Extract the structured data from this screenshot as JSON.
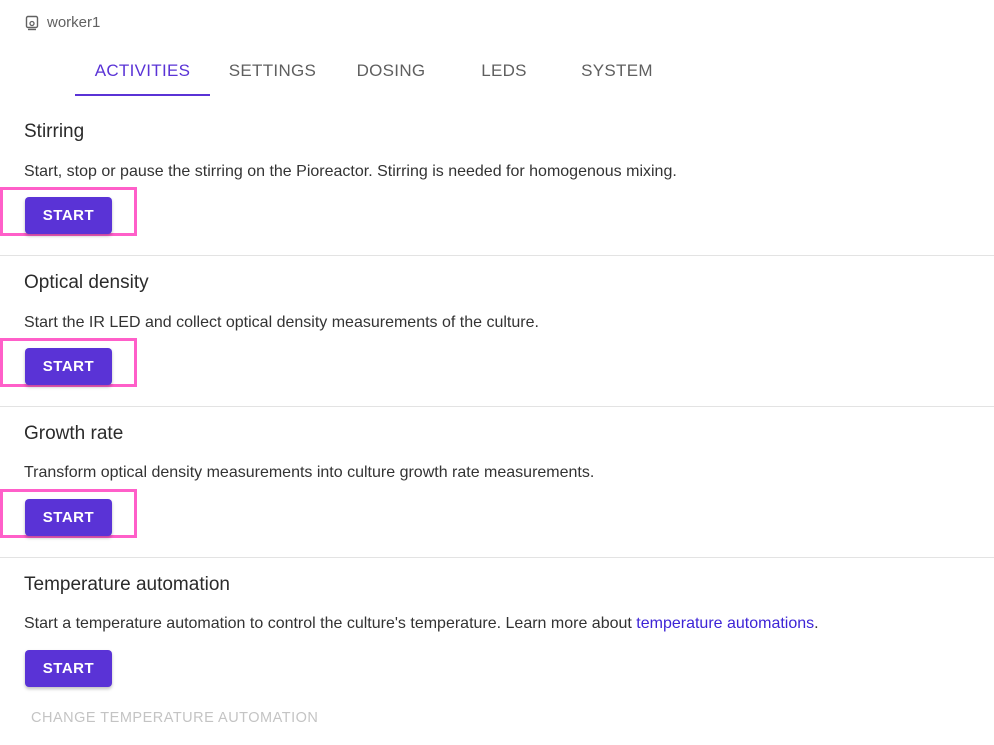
{
  "device": {
    "name": "worker1",
    "icon": "pioreactor-device-icon"
  },
  "tabs": [
    {
      "label": "ACTIVITIES",
      "active": true
    },
    {
      "label": "SETTINGS",
      "active": false
    },
    {
      "label": "DOSING",
      "active": false
    },
    {
      "label": "LEDS",
      "active": false
    },
    {
      "label": "SYSTEM",
      "active": false
    }
  ],
  "sections": [
    {
      "title": "Stirring",
      "description": "Start, stop or pause the stirring on the Pioreactor. Stirring is needed for homogenous mixing.",
      "button": "START",
      "highlighted": true
    },
    {
      "title": "Optical density",
      "description": "Start the IR LED and collect optical density measurements of the culture.",
      "button": "START",
      "highlighted": true
    },
    {
      "title": "Growth rate",
      "description": "Transform optical density measurements into culture growth rate measurements.",
      "button": "START",
      "highlighted": true
    },
    {
      "title": "Temperature automation",
      "description": "Start a temperature automation to control the culture's temperature. Learn more about ",
      "link_text": "temperature automations",
      "description_end": ".",
      "button": "START",
      "highlighted": false
    }
  ],
  "change_automation_label": "CHANGE TEMPERATURE AUTOMATION",
  "colors": {
    "accent": "#5a33d6",
    "highlight": "#ff5fc9",
    "link": "#3d24d6"
  }
}
